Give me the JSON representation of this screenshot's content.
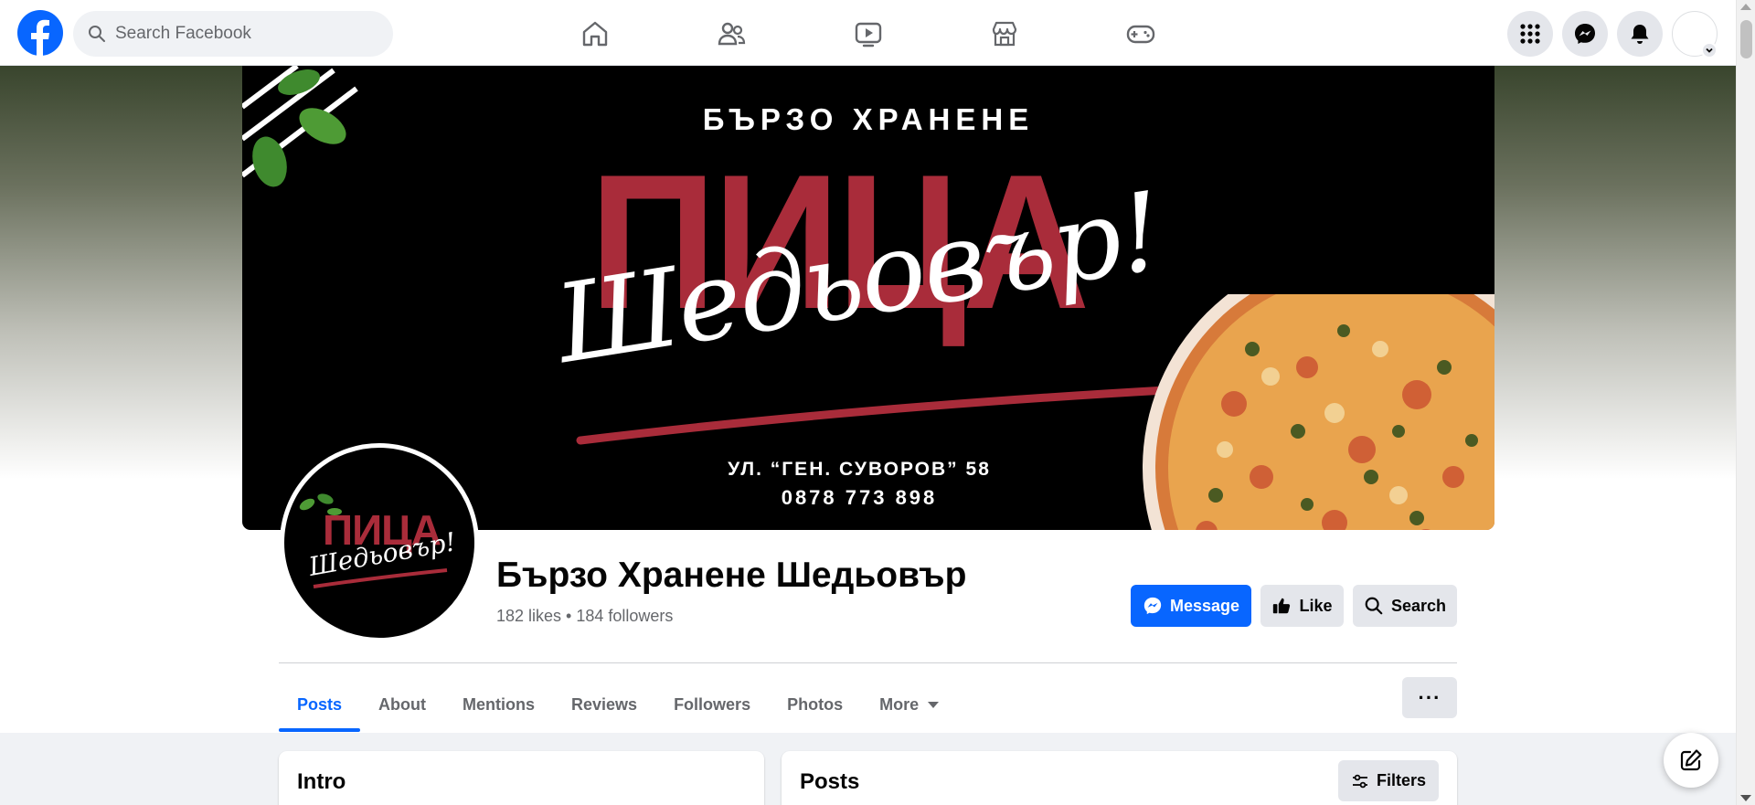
{
  "topnav": {
    "logo_icon": "facebook-logo-icon",
    "search_placeholder": "Search Facebook",
    "tabs": [
      "home-icon",
      "friends-icon",
      "watch-icon",
      "marketplace-icon",
      "gaming-icon"
    ],
    "right_buttons": [
      "menu-grid-icon",
      "messenger-icon",
      "notifications-bell-icon"
    ]
  },
  "cover": {
    "subtitle": "БЪРЗО ХРАНЕНЕ",
    "title_word": "ПИЦА",
    "script_word": "Шедьовър!",
    "address": "УЛ. “ГЕН. СУВОРОВ” 58",
    "phone": "0878 773 898"
  },
  "profile": {
    "pic_word": "ПИЦА",
    "pic_script": "Шедьовър!",
    "name": "Бързо Хранене Шедьовър",
    "stats": "182 likes • 184 followers"
  },
  "actions": {
    "message": "Message",
    "like": "Like",
    "search": "Search"
  },
  "tabs": [
    {
      "label": "Posts",
      "active": true
    },
    {
      "label": "About"
    },
    {
      "label": "Mentions"
    },
    {
      "label": "Reviews"
    },
    {
      "label": "Followers"
    },
    {
      "label": "Photos"
    },
    {
      "label": "More"
    }
  ],
  "more_button": "···",
  "intro": {
    "title": "Intro"
  },
  "posts": {
    "title": "Posts",
    "filters": "Filters"
  },
  "colors": {
    "brand_blue": "#0866ff",
    "pizza_red": "#a92c3a",
    "bg_gray": "#f0f2f5"
  }
}
